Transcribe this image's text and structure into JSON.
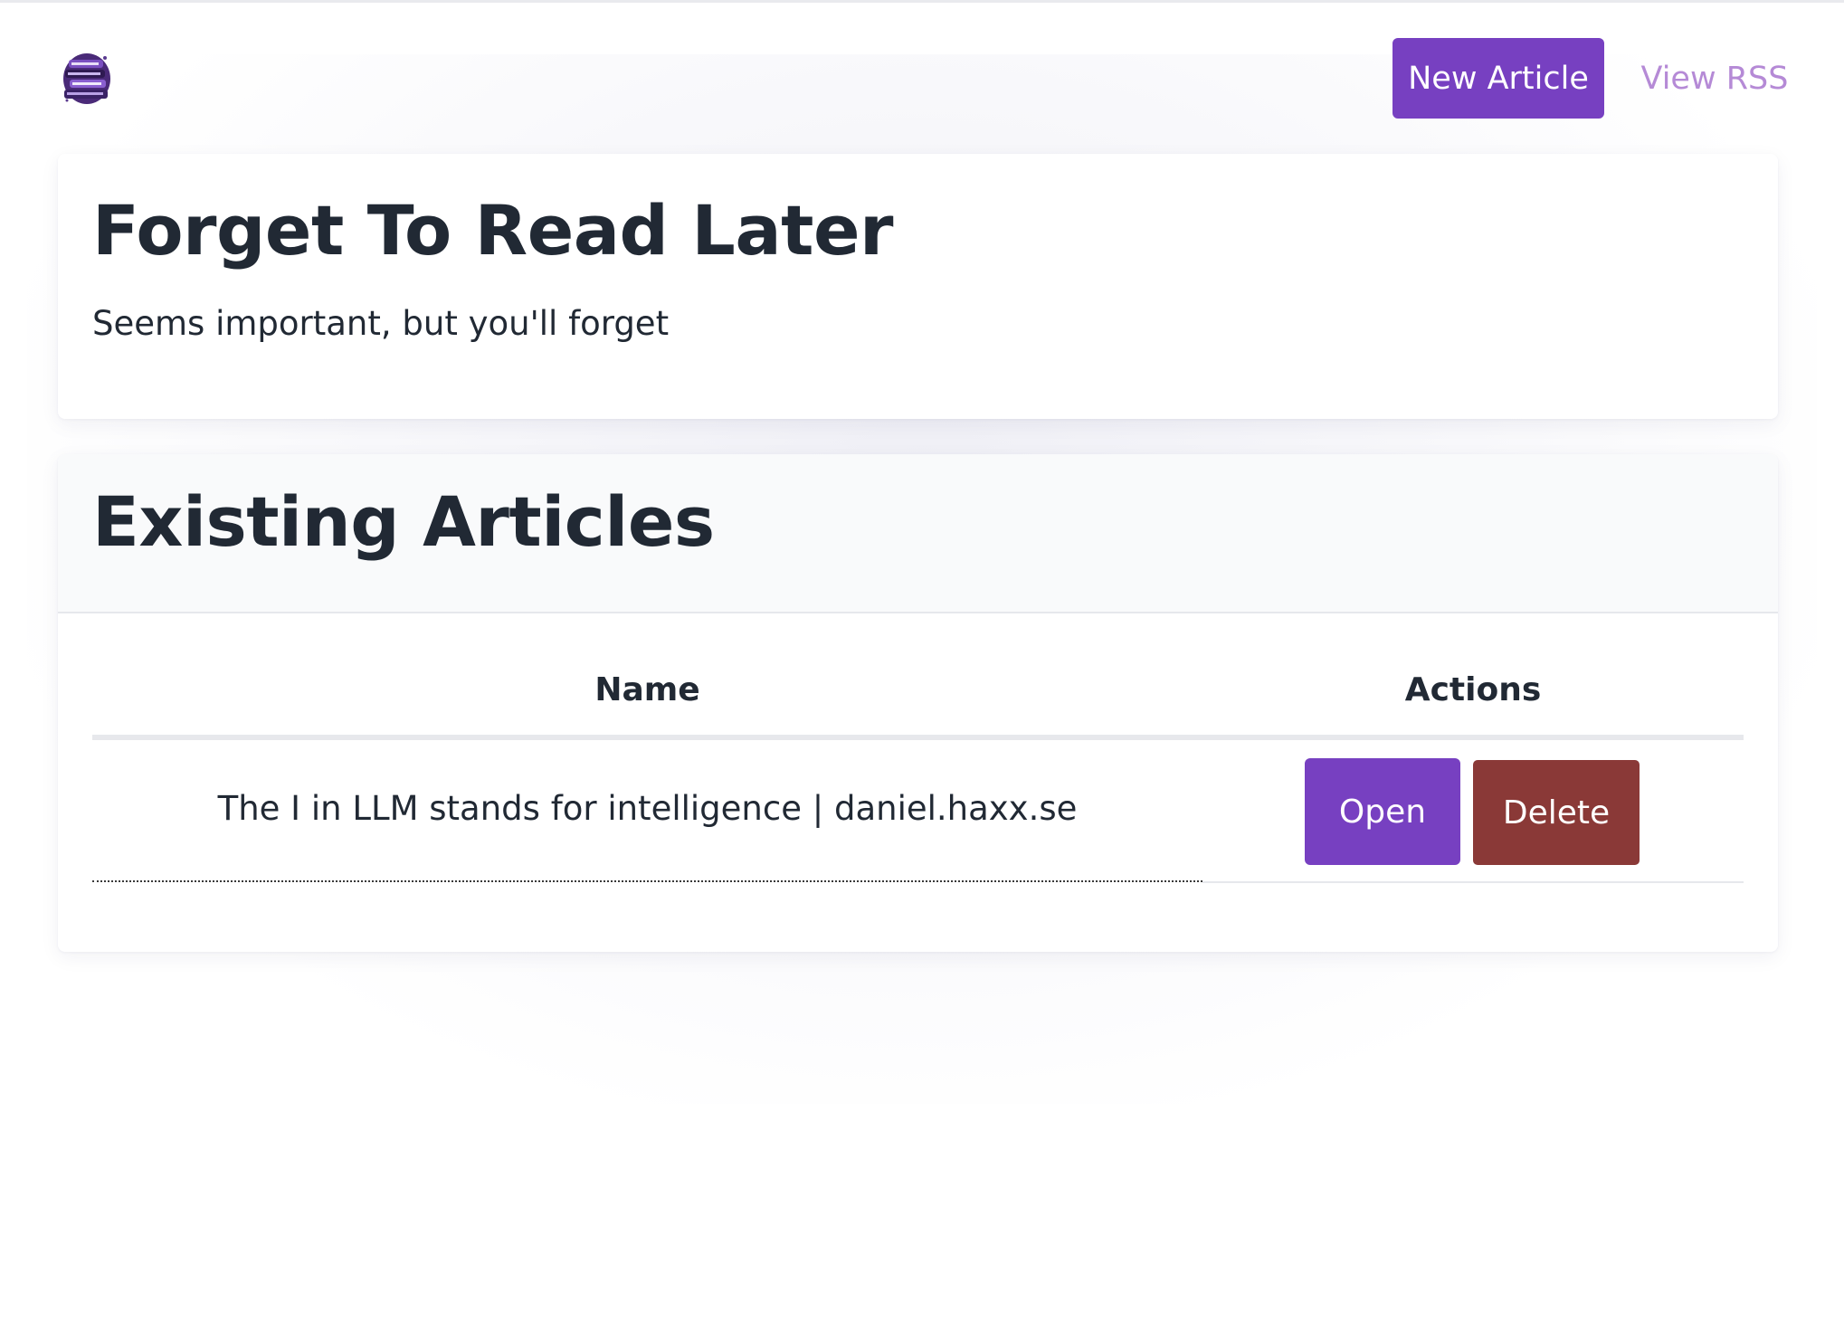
{
  "header": {
    "logo_icon": "book-stack-logo-icon",
    "new_article_label": "New Article",
    "view_rss_label": "View RSS"
  },
  "intro": {
    "title": "Forget To Read Later",
    "tagline": "Seems important, but you'll forget"
  },
  "articles": {
    "title": "Existing Articles",
    "columns": [
      "Name",
      "Actions"
    ],
    "rows": [
      {
        "name": "The I in LLM stands for intelligence | daniel.haxx.se",
        "open_label": "Open",
        "delete_label": "Delete"
      }
    ]
  },
  "colors": {
    "primary": "#7740c1",
    "danger": "#8a3937",
    "link": "#b58ad6",
    "text": "#212934"
  }
}
